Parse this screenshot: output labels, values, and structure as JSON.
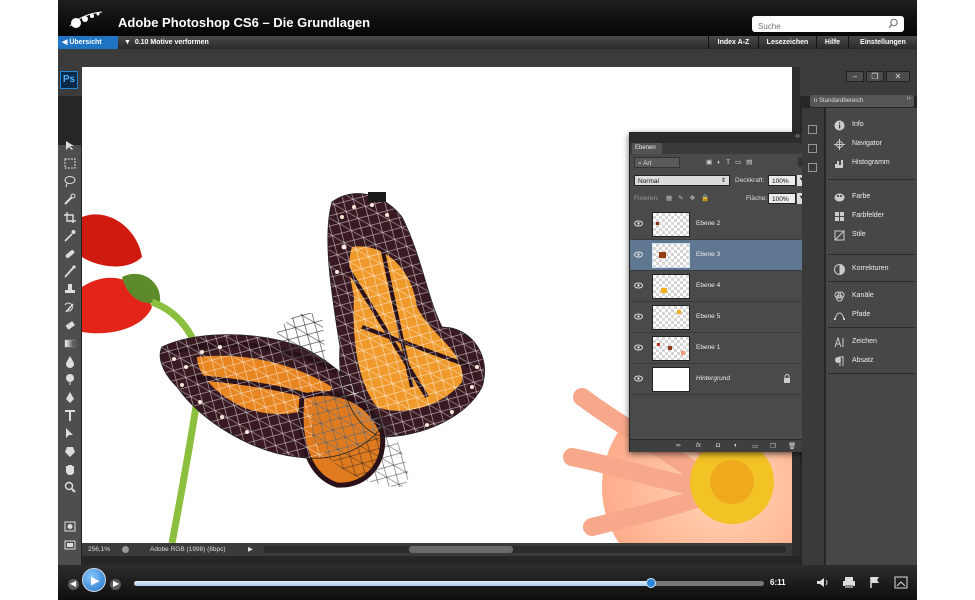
{
  "header": {
    "course_title": "Adobe Photoshop CS6 – Die Grundlagen",
    "search_placeholder": "Suche"
  },
  "nav": {
    "overview": "Übersicht",
    "current": "0.10 Motive verformen",
    "buttons": [
      "Index A-Z",
      "Lesezeichen",
      "Hilfe",
      "Einstellungen"
    ]
  },
  "photoshop": {
    "logo": "Ps",
    "workspace": "n Standardbereich",
    "status": {
      "zoom": "256,1%",
      "profile": "Adobe RGB (1998) (8bpc)"
    },
    "layers_panel": {
      "tab": "Ebenen",
      "filter": "Art",
      "blend_mode": "Normal",
      "opacity_label": "Deckkraft:",
      "opacity_value": "100%",
      "lock_label": "Fixieren:",
      "fill_label": "Fläche:",
      "fill_value": "100%",
      "layers": [
        {
          "name": "Ebene 2",
          "selected": false
        },
        {
          "name": "Ebene 3",
          "selected": true
        },
        {
          "name": "Ebene 4",
          "selected": false
        },
        {
          "name": "Ebene 5",
          "selected": false
        },
        {
          "name": "Ebene 1",
          "selected": false
        },
        {
          "name": "Hintergrund",
          "selected": false
        }
      ]
    },
    "dock": {
      "group1": [
        "Info",
        "Navigator",
        "Histogramm"
      ],
      "group2": [
        "Farbe",
        "Farbfelder",
        "Stile"
      ],
      "group3": [
        "Korrekturen"
      ],
      "group4": [
        "Kanäle",
        "Pfade"
      ],
      "group5": [
        "Zeichen",
        "Absatz"
      ]
    }
  },
  "player": {
    "time": "6:11",
    "progress": 0.82
  },
  "colors": {
    "accent": "#1f74c4",
    "selected_layer": "#5f7791"
  }
}
